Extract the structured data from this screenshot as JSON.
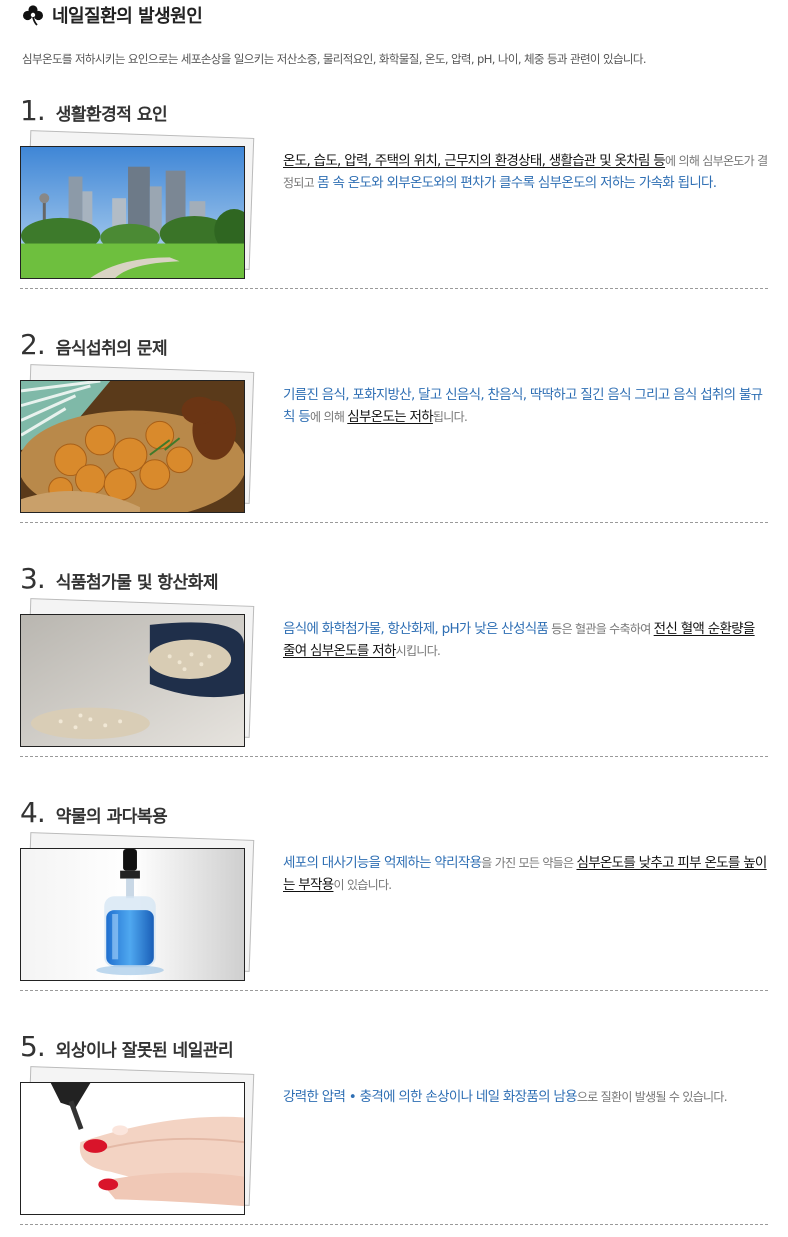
{
  "header": {
    "icon": "clover-icon",
    "title": "네일질환의 발생원인"
  },
  "intro": "심부온도를 저하시키는 요인으로는 세포손상을 일으키는 저산소증, 물리적요인, 화학물질, 온도, 압력, pH, 나이, 체중 등과 관련이 있습니다.",
  "colors": {
    "accent_blue": "#2f6fb4",
    "divider": "#9a9a9a"
  },
  "sections": [
    {
      "num": "1",
      "title": "생활환경적 요인",
      "image": "city-park-photo",
      "desc": [
        {
          "text": "온도, 습도, 압력, 주택의 위치, 근무지의 환경상태, 생활습관 및 옷차림 등",
          "style": "ul"
        },
        {
          "text": "에 의해 심부온도가 결정되고 ",
          "style": "small"
        },
        {
          "text": "몸 속 온도와 외부온도와의 편차가 클수록 심부온도의 저하는 가속화 됩니다.",
          "style": "blue"
        }
      ]
    },
    {
      "num": "2",
      "title": "음식섭취의 문제",
      "image": "fried-chicken-photo",
      "desc": [
        {
          "text": "기름진 음식, 포화지방산, 달고 신음식, 찬음식, 딱딱하고 질긴 음식 그리고 음식 섭취의 불규칙 등",
          "style": "blue"
        },
        {
          "text": "에 의해 ",
          "style": "small"
        },
        {
          "text": "심부온도는 저하",
          "style": "ul"
        },
        {
          "text": "됩니다.",
          "style": "small"
        }
      ]
    },
    {
      "num": "3",
      "title": "식품첨가물 및 항산화제",
      "image": "grains-bowl-photo",
      "desc": [
        {
          "text": "음식에 화학첨가물, 항산화제, pH가 낮은 산성식품",
          "style": "blue"
        },
        {
          "text": " 등은 혈관을 수축하여 ",
          "style": "small"
        },
        {
          "text": "전신 혈액 순환량을 줄여 심부온도를 저하",
          "style": "ul"
        },
        {
          "text": "시킵니다.",
          "style": "small"
        }
      ]
    },
    {
      "num": "4",
      "title": "약물의 과다복용",
      "image": "dropper-bottle-photo",
      "desc": [
        {
          "text": "세포의 대사기능을 억제하는 약리작용",
          "style": "blue"
        },
        {
          "text": "을 가진 모든 약들은 ",
          "style": "small"
        },
        {
          "text": "심부온도를 낮추고 피부 온도를 높이는 부작용",
          "style": "ul"
        },
        {
          "text": "이 있습니다.",
          "style": "small"
        }
      ]
    },
    {
      "num": "5",
      "title": "외상이나 잘못된 네일관리",
      "image": "nail-polish-photo",
      "desc": [
        {
          "text": "강력한 압력 • 충격에 의한 손상이나 네일 화장품의 남용",
          "style": "blue"
        },
        {
          "text": "으로 질환이 발생될 수 있습니다.",
          "style": "small"
        }
      ]
    }
  ]
}
